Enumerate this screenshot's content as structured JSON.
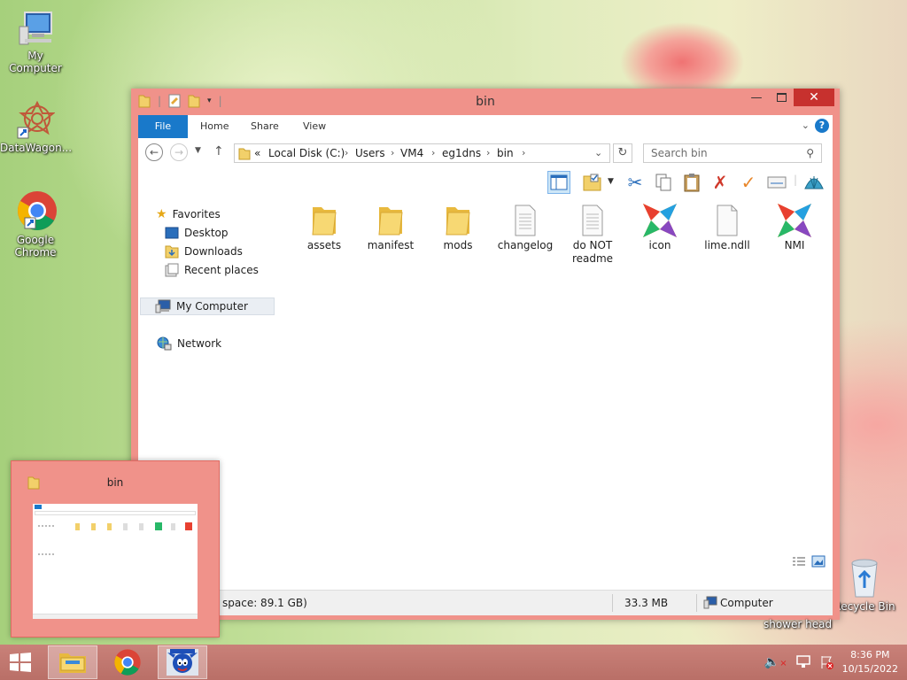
{
  "desktop": {
    "icons": [
      {
        "label": "My Computer",
        "icon": "computer-icon"
      },
      {
        "label": "DataWagon...",
        "icon": "datawagon-icon"
      },
      {
        "label": "Google Chrome",
        "icon": "chrome-icon"
      }
    ],
    "recycle_bin": {
      "label": "Recycle Bin"
    },
    "stray_label": "shower head"
  },
  "window": {
    "title": "bin",
    "ribbon_tabs": [
      "File",
      "Home",
      "Share",
      "View"
    ],
    "address": {
      "overflow": "«",
      "crumbs": [
        "Local Disk (C:)",
        "Users",
        "VM4",
        "eg1dns",
        "bin"
      ]
    },
    "search_placeholder": "Search bin",
    "nav": {
      "favorites": "Favorites",
      "desktop": "Desktop",
      "downloads": "Downloads",
      "recent": "Recent places",
      "computer": "My Computer",
      "network": "Network"
    },
    "files": [
      {
        "name": "assets",
        "type": "folder"
      },
      {
        "name": "manifest",
        "type": "folder"
      },
      {
        "name": "mods",
        "type": "folder"
      },
      {
        "name": "changelog",
        "type": "text"
      },
      {
        "name": "do NOT readme",
        "type": "text"
      },
      {
        "name": "icon",
        "type": "haxe"
      },
      {
        "name": "lime.ndll",
        "type": "file"
      },
      {
        "name": "NMI",
        "type": "haxe"
      }
    ],
    "status": {
      "free_space": "space: 89.1 GB)",
      "size": "33.3 MB",
      "location": "Computer"
    }
  },
  "thumbnail": {
    "title": "bin"
  },
  "taskbar": {
    "clock_time": "8:36 PM",
    "clock_date": "10/15/2022"
  },
  "colors": {
    "window_frame": "#f0928a",
    "ribbon_file": "#1979ca",
    "close_button": "#c7312e",
    "taskbar": "#c47a72"
  }
}
